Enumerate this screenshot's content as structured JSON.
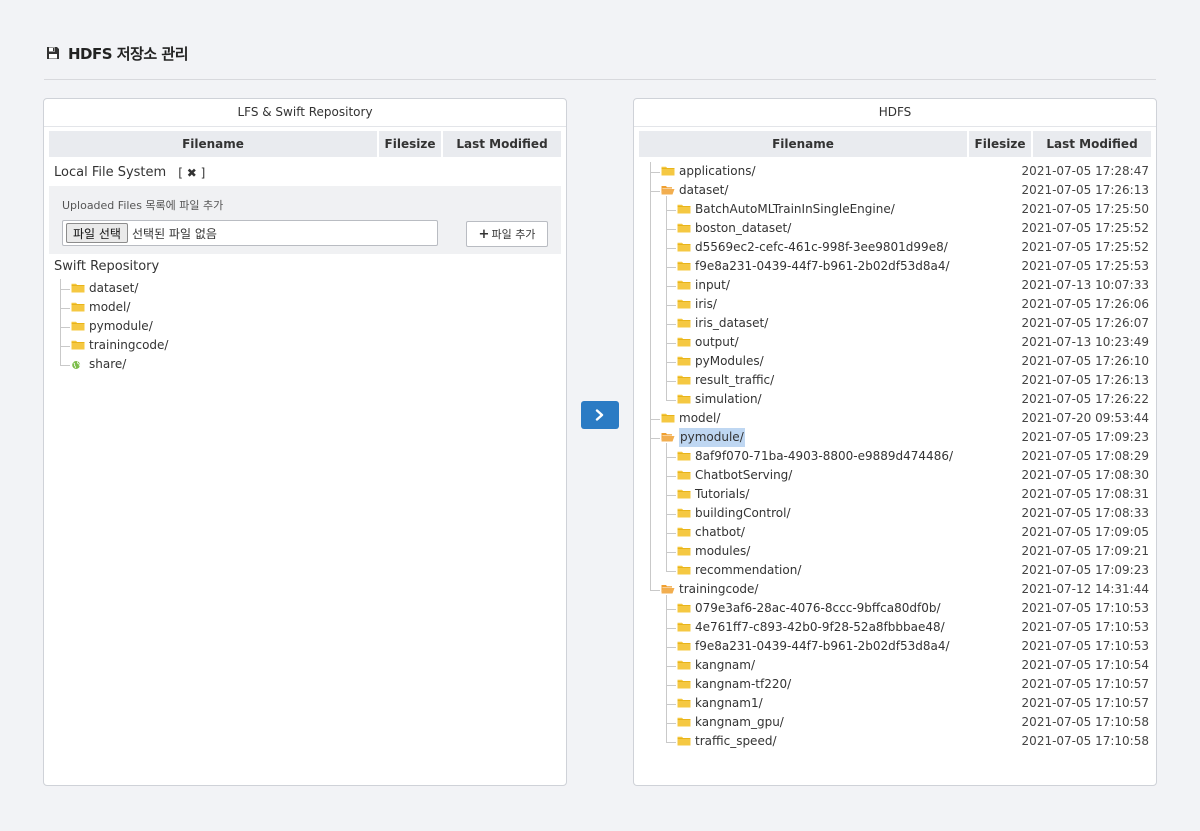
{
  "header": {
    "title": "HDFS 저장소 관리",
    "icon": "save-icon"
  },
  "left_panel": {
    "title": "LFS & Swift Repository",
    "columns": [
      "Filename",
      "Filesize",
      "Last Modified"
    ],
    "local": {
      "title": "Local File System",
      "close_open": "[",
      "close_symbol": "✖",
      "close_close": "]",
      "upload_label": "Uploaded Files 목록에 파일 추가",
      "choose_button": "파일 선택",
      "no_file": "선택된 파일 없음",
      "add_button": "파일 추가"
    },
    "swift": {
      "title": "Swift Repository",
      "items": [
        {
          "name": "dataset/",
          "icon": "folder-icon"
        },
        {
          "name": "model/",
          "icon": "folder-icon"
        },
        {
          "name": "pymodule/",
          "icon": "folder-icon"
        },
        {
          "name": "trainingcode/",
          "icon": "folder-icon"
        },
        {
          "name": "share/",
          "icon": "globe-icon"
        }
      ]
    }
  },
  "right_panel": {
    "title": "HDFS",
    "columns": [
      "Filename",
      "Filesize",
      "Last Modified"
    ],
    "rows": [
      {
        "level": 0,
        "name": "applications/",
        "open": false,
        "date": "2021-07-05 17:28:47"
      },
      {
        "level": 0,
        "name": "dataset/",
        "open": true,
        "date": "2021-07-05 17:26:13"
      },
      {
        "level": 1,
        "name": "BatchAutoMLTrainInSingleEngine/",
        "open": false,
        "date": "2021-07-05 17:25:50"
      },
      {
        "level": 1,
        "name": "boston_dataset/",
        "open": false,
        "date": "2021-07-05 17:25:52"
      },
      {
        "level": 1,
        "name": "d5569ec2-cefc-461c-998f-3ee9801d99e8/",
        "open": false,
        "date": "2021-07-05 17:25:52"
      },
      {
        "level": 1,
        "name": "f9e8a231-0439-44f7-b961-2b02df53d8a4/",
        "open": false,
        "date": "2021-07-05 17:25:53"
      },
      {
        "level": 1,
        "name": "input/",
        "open": false,
        "date": "2021-07-13 10:07:33"
      },
      {
        "level": 1,
        "name": "iris/",
        "open": false,
        "date": "2021-07-05 17:26:06"
      },
      {
        "level": 1,
        "name": "iris_dataset/",
        "open": false,
        "date": "2021-07-05 17:26:07"
      },
      {
        "level": 1,
        "name": "output/",
        "open": false,
        "date": "2021-07-13 10:23:49"
      },
      {
        "level": 1,
        "name": "pyModules/",
        "open": false,
        "date": "2021-07-05 17:26:10"
      },
      {
        "level": 1,
        "name": "result_traffic/",
        "open": false,
        "date": "2021-07-05 17:26:13"
      },
      {
        "level": 1,
        "name": "simulation/",
        "open": false,
        "date": "2021-07-05 17:26:22"
      },
      {
        "level": 0,
        "name": "model/",
        "open": false,
        "date": "2021-07-20 09:53:44"
      },
      {
        "level": 0,
        "name": "pymodule/",
        "open": true,
        "selected": true,
        "date": "2021-07-05 17:09:23"
      },
      {
        "level": 1,
        "name": "8af9f070-71ba-4903-8800-e9889d474486/",
        "open": false,
        "date": "2021-07-05 17:08:29"
      },
      {
        "level": 1,
        "name": "ChatbotServing/",
        "open": false,
        "date": "2021-07-05 17:08:30"
      },
      {
        "level": 1,
        "name": "Tutorials/",
        "open": false,
        "date": "2021-07-05 17:08:31"
      },
      {
        "level": 1,
        "name": "buildingControl/",
        "open": false,
        "date": "2021-07-05 17:08:33"
      },
      {
        "level": 1,
        "name": "chatbot/",
        "open": false,
        "date": "2021-07-05 17:09:05"
      },
      {
        "level": 1,
        "name": "modules/",
        "open": false,
        "date": "2021-07-05 17:09:21"
      },
      {
        "level": 1,
        "name": "recommendation/",
        "open": false,
        "date": "2021-07-05 17:09:23"
      },
      {
        "level": 0,
        "name": "trainingcode/",
        "open": true,
        "date": "2021-07-12 14:31:44"
      },
      {
        "level": 1,
        "name": "079e3af6-28ac-4076-8ccc-9bffca80df0b/",
        "open": false,
        "date": "2021-07-05 17:10:53"
      },
      {
        "level": 1,
        "name": "4e761ff7-c893-42b0-9f28-52a8fbbbae48/",
        "open": false,
        "date": "2021-07-05 17:10:53"
      },
      {
        "level": 1,
        "name": "f9e8a231-0439-44f7-b961-2b02df53d8a4/",
        "open": false,
        "date": "2021-07-05 17:10:53"
      },
      {
        "level": 1,
        "name": "kangnam/",
        "open": false,
        "date": "2021-07-05 17:10:54"
      },
      {
        "level": 1,
        "name": "kangnam-tf220/",
        "open": false,
        "date": "2021-07-05 17:10:57"
      },
      {
        "level": 1,
        "name": "kangnam1/",
        "open": false,
        "date": "2021-07-05 17:10:57"
      },
      {
        "level": 1,
        "name": "kangnam_gpu/",
        "open": false,
        "date": "2021-07-05 17:10:58"
      },
      {
        "level": 1,
        "name": "traffic_speed/",
        "open": false,
        "date": "2021-07-05 17:10:58"
      }
    ]
  },
  "transfer_button": {
    "icon": "chevron-right-icon"
  },
  "colors": {
    "folder": "#f5c842",
    "folder_dark": "#e0a800",
    "open_folder": "#f0a030",
    "globe": "#7cbd4a",
    "accent": "#2b7bc4"
  }
}
